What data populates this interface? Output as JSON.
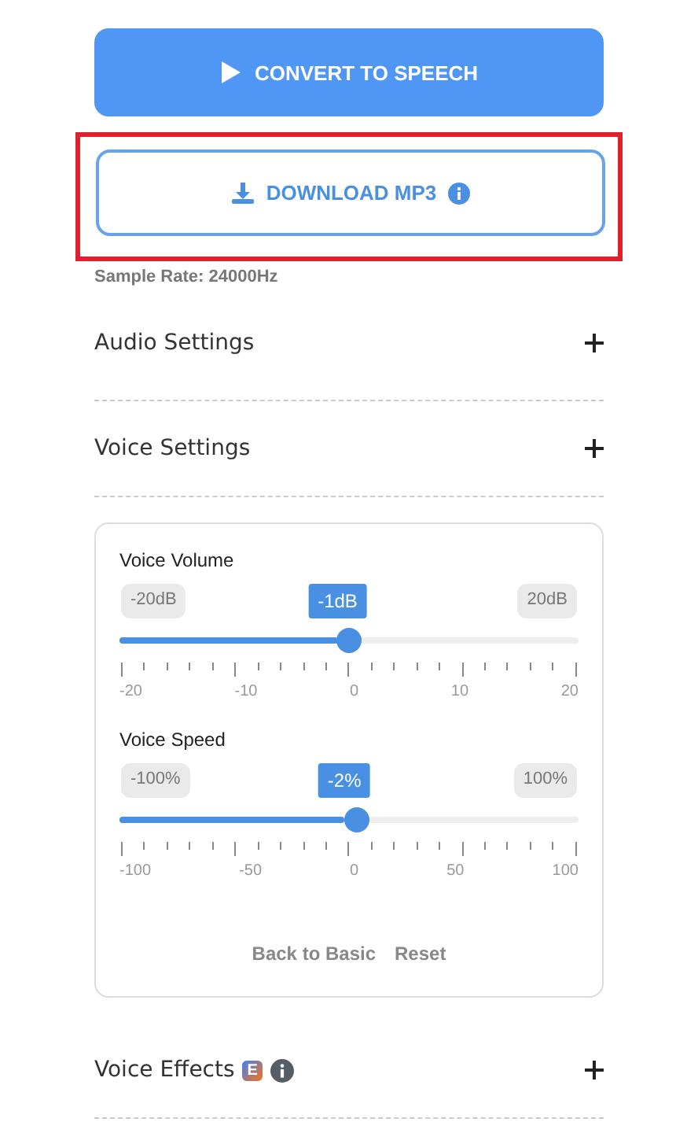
{
  "primary_button": {
    "label": "CONVERT TO SPEECH"
  },
  "download_button": {
    "label": "DOWNLOAD MP3",
    "highlighted": true
  },
  "sample_rate": "Sample Rate: 24000Hz",
  "sections_top": [
    {
      "title": "Audio Settings"
    },
    {
      "title": "Voice Settings"
    }
  ],
  "sliders": [
    {
      "label": "Voice Volume",
      "min_label": "-20dB",
      "max_label": "20dB",
      "value_label": "-1dB",
      "level": 0.475,
      "ticks": [
        "-20",
        "-10",
        "0",
        "10",
        "20"
      ]
    },
    {
      "label": "Voice Speed",
      "min_label": "-100%",
      "max_label": "100%",
      "value_label": "-2%",
      "level": 0.49,
      "ticks": [
        "-100",
        "-50",
        "0",
        "50",
        "100"
      ]
    }
  ],
  "card_links": [
    "Back to Basic",
    "Reset"
  ],
  "sections_bottom": [
    {
      "title": "Voice Effects",
      "badge": "E"
    }
  ]
}
